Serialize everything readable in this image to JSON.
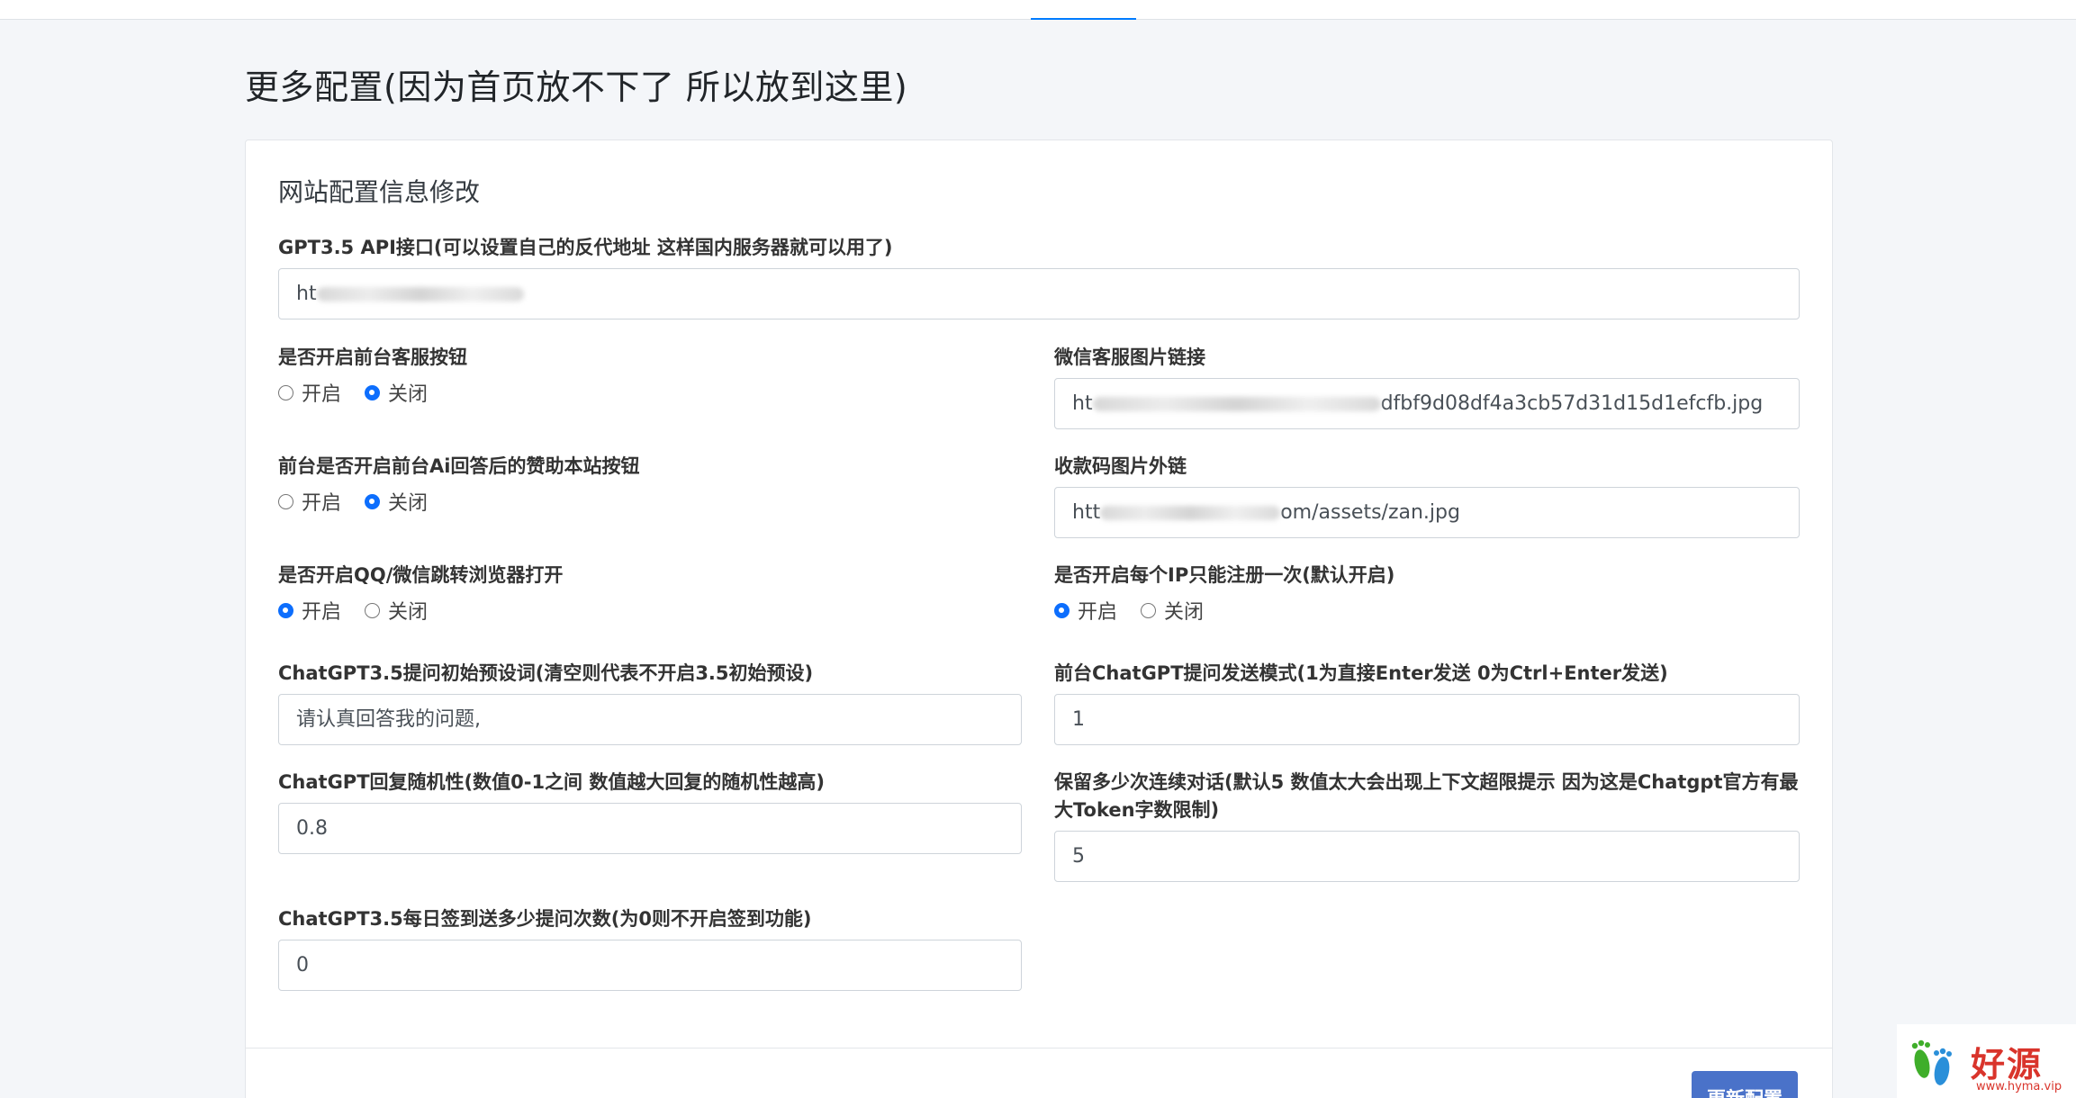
{
  "page": {
    "title": "更多配置(因为首页放不下了 所以放到这里)"
  },
  "card": {
    "title": "网站配置信息修改"
  },
  "fields": {
    "api": {
      "label": "GPT3.5 API接口(可以设置自己的反代地址 这样国内服务器就可以用了)",
      "value_prefix": "ht"
    },
    "service_button": {
      "label": "是否开启前台客服按钮",
      "options": [
        "开启",
        "关闭"
      ],
      "selected": "关闭"
    },
    "wechat_image": {
      "label": "微信客服图片链接",
      "value_prefix": "ht",
      "value_suffix": "dfbf9d08df4a3cb57d31d15d1efcfb.jpg"
    },
    "sponsor_button": {
      "label": "前台是否开启前台Ai回答后的赞助本站按钮",
      "options": [
        "开启",
        "关闭"
      ],
      "selected": "关闭"
    },
    "qr_image": {
      "label": "收款码图片外链",
      "value_prefix": "htt",
      "value_suffix": "om/assets/zan.jpg"
    },
    "browser_jump": {
      "label": "是否开启QQ/微信跳转浏览器打开",
      "options": [
        "开启",
        "关闭"
      ],
      "selected": "开启"
    },
    "ip_once": {
      "label": "是否开启每个IP只能注册一次(默认开启)",
      "options": [
        "开启",
        "关闭"
      ],
      "selected": "开启"
    },
    "preset_prompt": {
      "label": "ChatGPT3.5提问初始预设词(清空则代表不开启3.5初始预设)",
      "value": "请认真回答我的问题,"
    },
    "send_mode": {
      "label": "前台ChatGPT提问发送模式(1为直接Enter发送 0为Ctrl+Enter发送)",
      "value": "1"
    },
    "randomness": {
      "label": "ChatGPT回复随机性(数值0-1之间 数值越大回复的随机性越高)",
      "value": "0.8"
    },
    "context_count": {
      "label": "保留多少次连续对话(默认5 数值太大会出现上下文超限提示 因为这是Chatgpt官方有最大Token字数限制)",
      "value": "5"
    },
    "checkin": {
      "label": "ChatGPT3.5每日签到送多少提问次数(为0则不开启签到功能)",
      "value": "0"
    }
  },
  "footer": {
    "save_label": "更新配置"
  },
  "watermark": {
    "text": "好源码",
    "url": "www.hyma.vip"
  },
  "colors": {
    "accent": "#0d6efd",
    "button": "#4a72c9",
    "watermark": "#d9342b"
  }
}
